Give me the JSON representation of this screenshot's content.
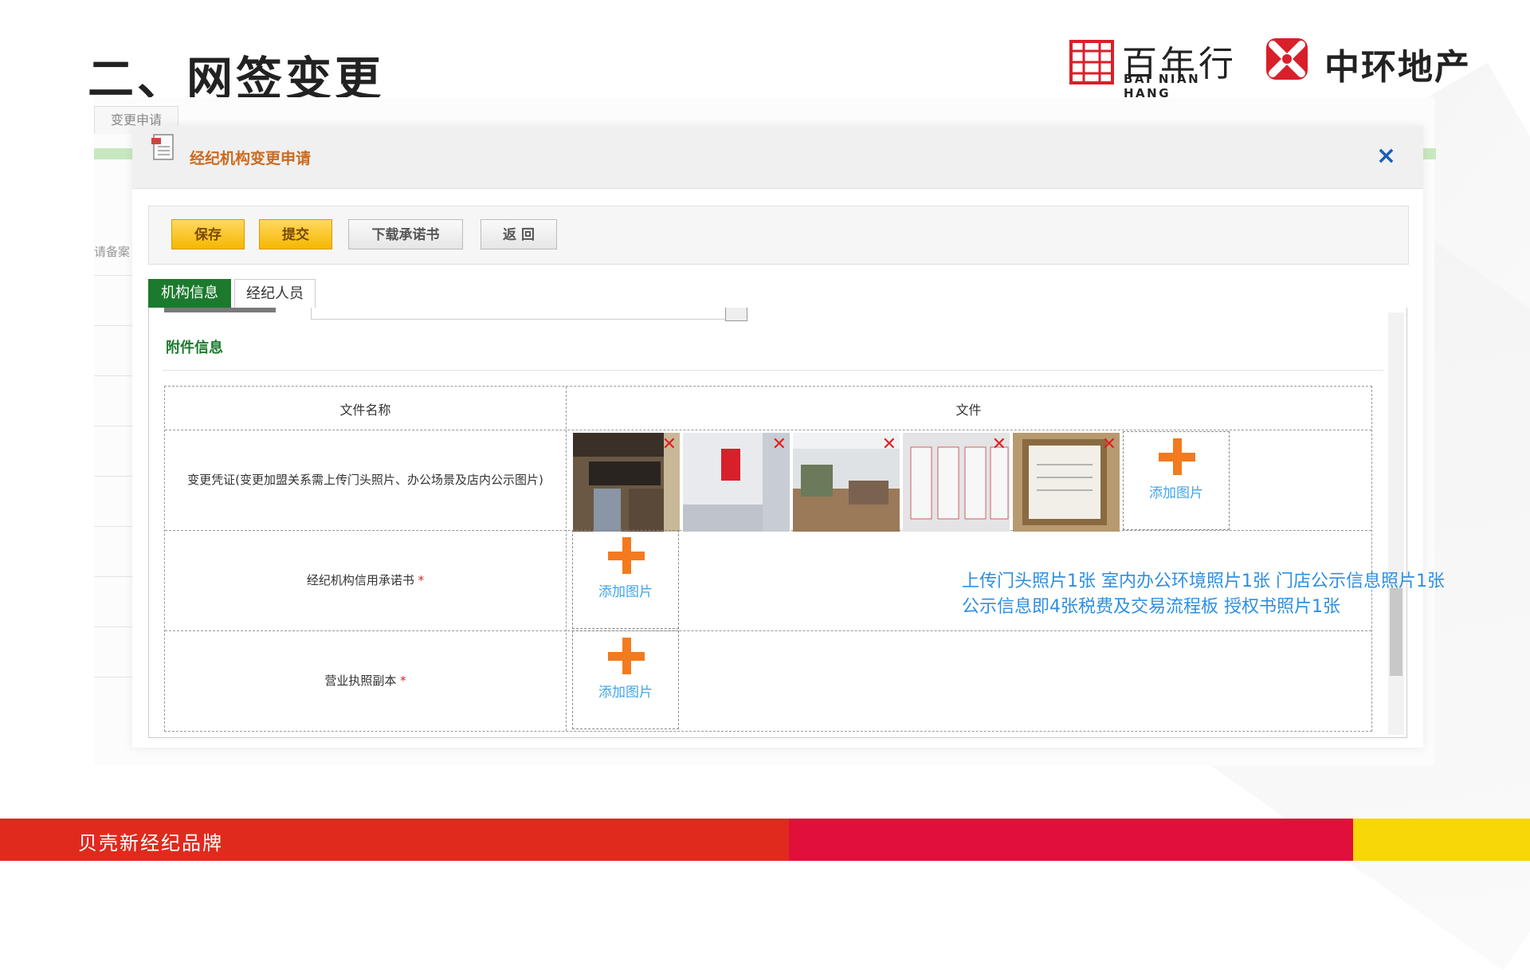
{
  "slide": {
    "title": "二、网签变更",
    "footer_text": "贝壳新经纪品牌",
    "logos": {
      "bnh_cn": "百年行",
      "bnh_en": "BAI NIAN HANG",
      "zhonghuan": "中环地产"
    }
  },
  "background_app": {
    "tab_label": "变更申请",
    "row_label": "请备案"
  },
  "dialog": {
    "title": "经纪机构变更申请",
    "close_label": "×",
    "toolbar": {
      "save": "保存",
      "submit": "提交",
      "download": "下载承诺书",
      "back": "返 回"
    },
    "tabs": [
      "机构信息",
      "经纪人员"
    ],
    "section_title": "附件信息",
    "table": {
      "headers": [
        "文件名称",
        "文件"
      ],
      "rows": [
        {
          "name": "变更凭证(变更加盟关系需上传门头照片、办公场景及店内公示图片)",
          "required": false
        },
        {
          "name": "经纪机构信用承诺书",
          "required": true
        },
        {
          "name": "营业执照副本",
          "required": true
        }
      ],
      "add_image_label": "添加图片",
      "remove_label": "✕",
      "required_mark": "*"
    },
    "note_lines": [
      "上传门头照片1张 室内办公环境照片1张  门店公示信息照片1张",
      "公示信息即4张税费及交易流程板  授权书照片1张"
    ]
  },
  "colors": {
    "footer_red": "#e02a1e",
    "footer_crimson": "#e0103a",
    "footer_yellow": "#f7d708",
    "dialog_title": "#cc6a1e",
    "section_green": "#1b7a2e",
    "plus_orange": "#f37a1f",
    "note_blue": "#2e8fe0"
  }
}
